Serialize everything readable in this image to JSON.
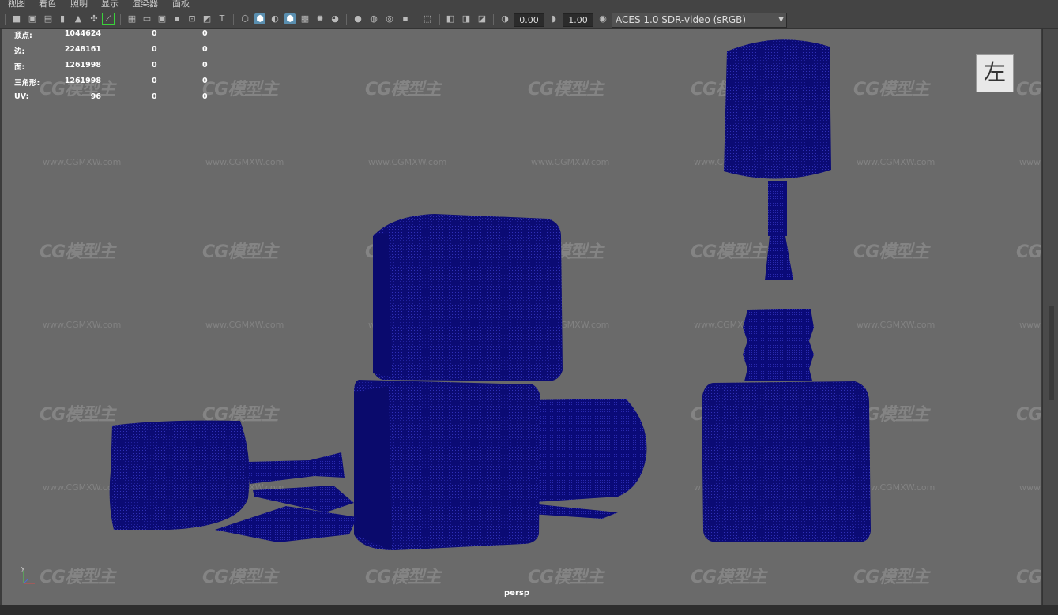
{
  "menu": [
    "视图",
    "着色",
    "照明",
    "显示",
    "渲染器",
    "面板"
  ],
  "toolbar": {
    "exposure_value": "0.00",
    "gamma_value": "1.00",
    "color_space": "ACES 1.0 SDR-video (sRGB)"
  },
  "hud": {
    "rows": [
      {
        "label": "顶点:",
        "v1": "1044624",
        "v2": "0",
        "v3": "0"
      },
      {
        "label": "边:",
        "v1": "2248161",
        "v2": "0",
        "v3": "0"
      },
      {
        "label": "面:",
        "v1": "1261998",
        "v2": "0",
        "v3": "0"
      },
      {
        "label": "三角形:",
        "v1": "1261998",
        "v2": "0",
        "v3": "0"
      },
      {
        "label": "UV:",
        "v1": "96",
        "v2": "0",
        "v3": "0"
      }
    ]
  },
  "view_cube_label": "左",
  "camera_label": "persp",
  "axis": {
    "y": "y",
    "x": "x",
    "z": "z"
  },
  "watermark": {
    "logo": "CG模型主",
    "url": "www.CGMXW.com"
  },
  "colors": {
    "mesh": "#0a0a78",
    "viewport_bg": "#6a6a6a",
    "accent": "#5a8fb0"
  }
}
